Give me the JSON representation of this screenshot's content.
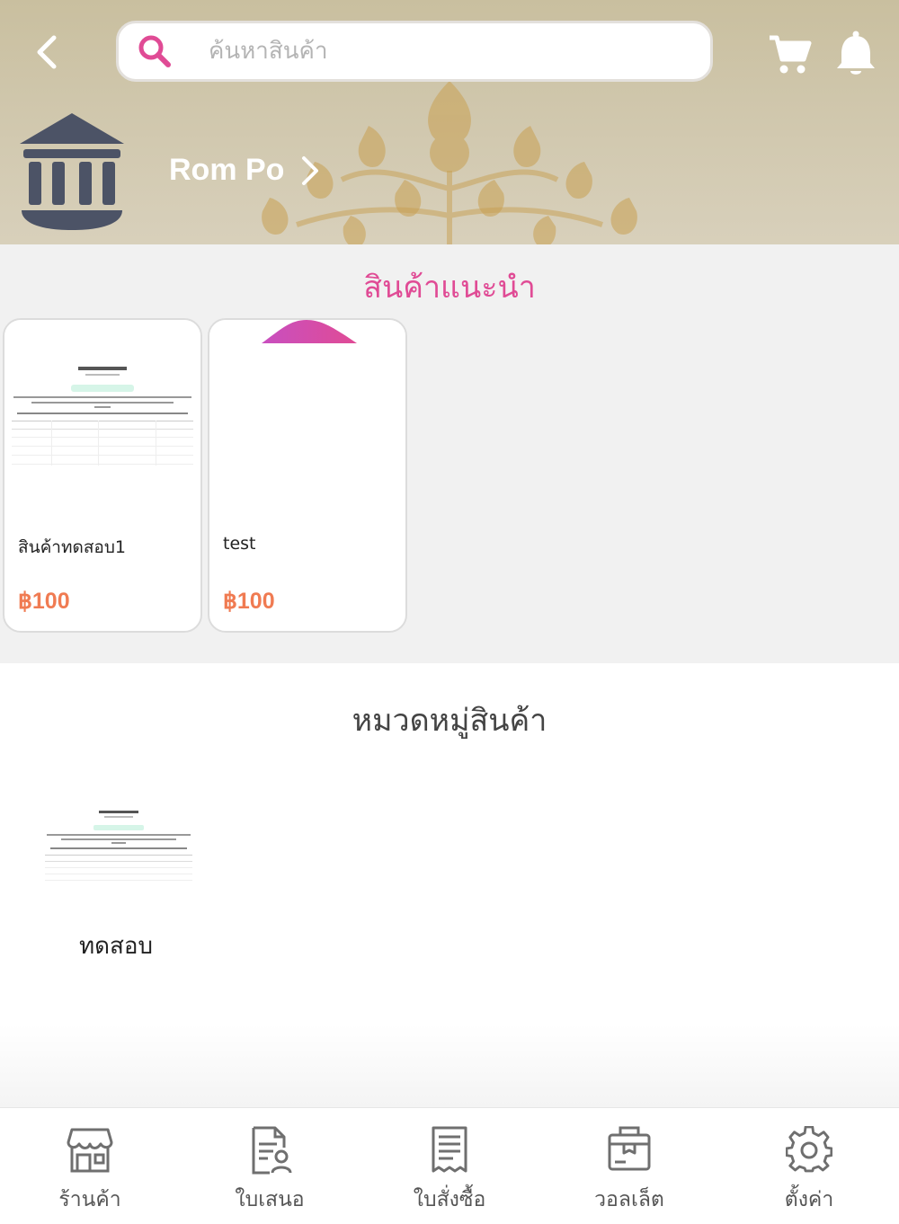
{
  "header": {
    "search_placeholder": "ค้นหาสินค้า",
    "shop_name": "Rom Po",
    "icons": {
      "back": "chevron-left-icon",
      "search": "search-icon",
      "cart": "cart-icon",
      "notification": "bell-icon",
      "shop": "bank-building-icon",
      "shop_link": "chevron-right-icon"
    }
  },
  "recommended": {
    "title": "สินค้าแนะนำ",
    "products": [
      {
        "name": "สินค้าทดสอบ1",
        "price": "฿100"
      },
      {
        "name": "test",
        "price": "฿100"
      }
    ]
  },
  "categories": {
    "title": "หมวดหมู่สินค้า",
    "items": [
      {
        "name": "ทดสอบ"
      }
    ]
  },
  "bottom_nav": {
    "items": [
      {
        "label": "ร้านค้า",
        "icon": "store-icon"
      },
      {
        "label": "ใบเสนอ",
        "icon": "quotation-icon"
      },
      {
        "label": "ใบสั่งซื้อ",
        "icon": "receipt-icon"
      },
      {
        "label": "วอลเล็ต",
        "icon": "wallet-icon"
      },
      {
        "label": "ตั้งค่า",
        "icon": "gear-icon"
      }
    ]
  },
  "colors": {
    "accent_pink": "#e04b95",
    "price_orange": "#f07b52",
    "header_bg": "#cfc6ab",
    "section_bg": "#f1f1f1"
  }
}
